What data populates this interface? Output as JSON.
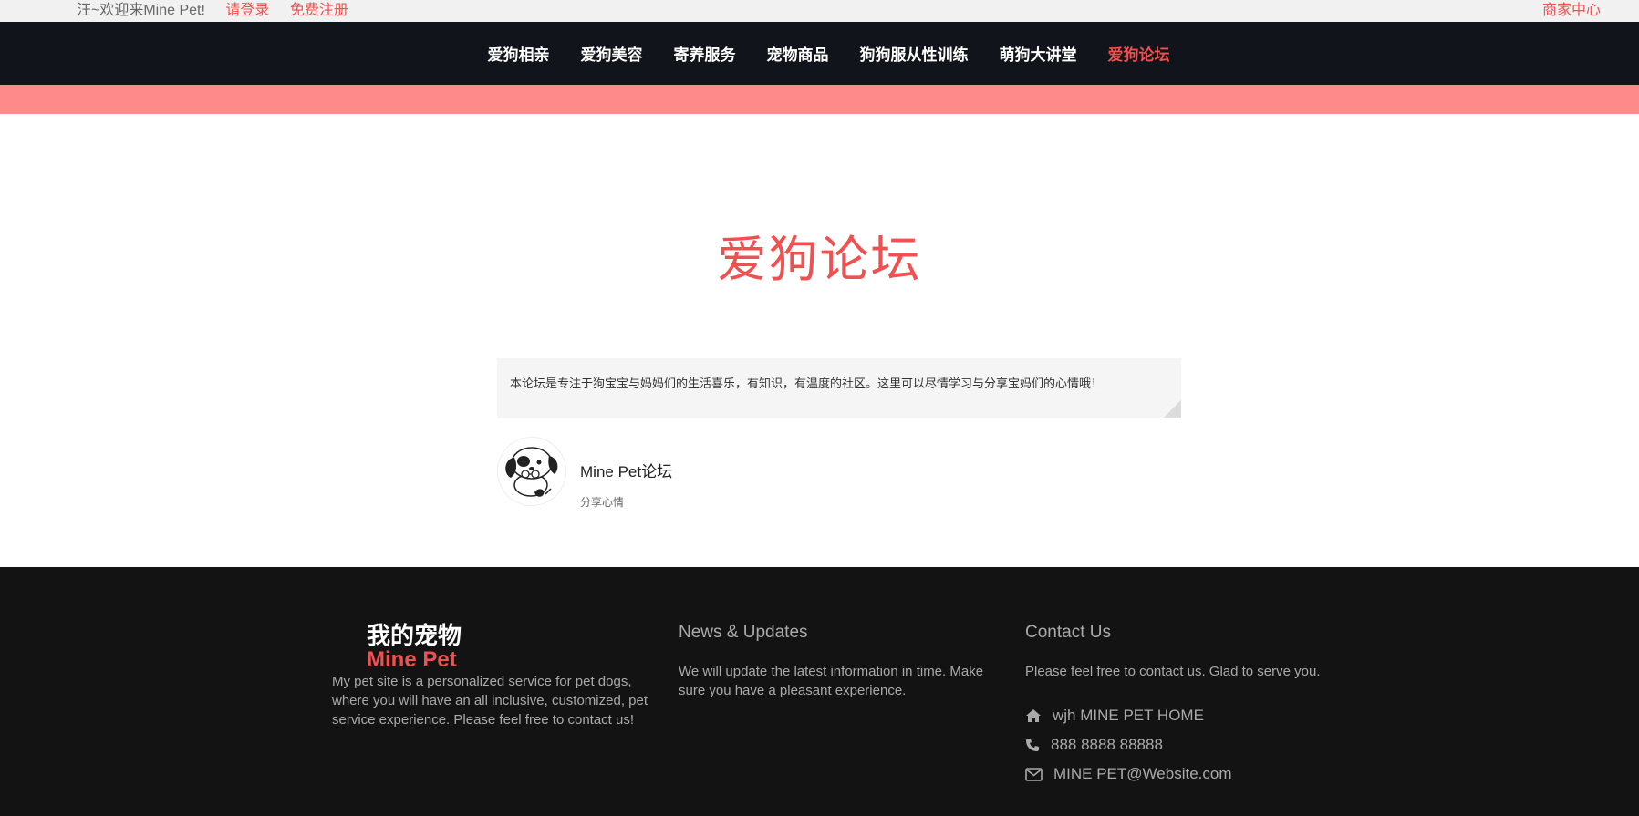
{
  "topbar": {
    "welcome": "汪~欢迎来Mine Pet!",
    "login": "请登录",
    "register": "免费注册",
    "merchant": "商家中心"
  },
  "nav": {
    "items": [
      {
        "label": "爱狗相亲"
      },
      {
        "label": "爱狗美容"
      },
      {
        "label": "寄养服务"
      },
      {
        "label": "宠物商品"
      },
      {
        "label": "狗狗服从性训练"
      },
      {
        "label": "萌狗大讲堂"
      },
      {
        "label": "爱狗论坛"
      }
    ],
    "active_index": 6
  },
  "main": {
    "title": "爱狗论坛",
    "description": "本论坛是专注于狗宝宝与妈妈们的生活喜乐，有知识，有温度的社区。这里可以尽情学习与分享宝妈们的心情哦！",
    "forum": {
      "name": "Mine Pet论坛",
      "subtitle": "分享心情",
      "avatar_icon": "puppy-avatar-icon"
    }
  },
  "footer": {
    "brand_cn": "我的宠物",
    "brand_en": "Mine Pet",
    "about": "My pet site is a personalized service for pet dogs, where you will have an all inclusive, customized, pet service experience. Please feel free to contact us!",
    "news_title": "News & Updates",
    "news_text": "We will update the latest information in time. Make sure you have a pleasant experience.",
    "contact_title": "Contact Us",
    "contact_text": "Please feel free to contact us. Glad to serve you.",
    "address": "wjh MINE PET HOME",
    "phone": "888 8888 88888",
    "email": "MINE PET@Website.com"
  },
  "colors": {
    "accent": "#f0504f",
    "nav_bg": "#11141b",
    "band": "#ff8a8a",
    "footer_bg": "#131313"
  }
}
